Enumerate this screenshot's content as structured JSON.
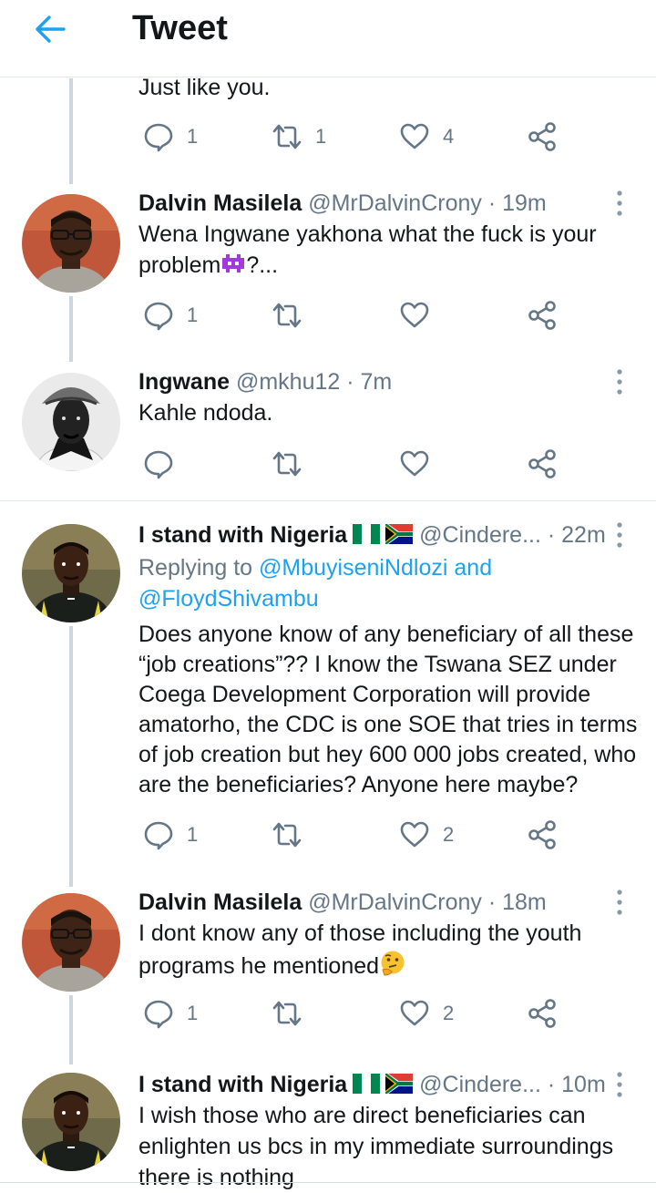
{
  "header": {
    "title": "Tweet"
  },
  "prev_tweet": {
    "text": "Just like you.",
    "replies": "1",
    "retweets": "1",
    "likes": "4"
  },
  "tweets": [
    {
      "name": "Dalvin Masilela",
      "handle": "@MrDalvinCrony",
      "time": "· 19m",
      "text1": "Wena Ingwane yakhona what the fuck is your",
      "text2_start": "problem",
      "text2_end": "?...",
      "replies": "1",
      "retweets": "",
      "likes": ""
    },
    {
      "name": "Ingwane",
      "handle": "@mkhu12",
      "time": "· 7m",
      "text1": "Kahle ndoda.",
      "replies": "",
      "retweets": "",
      "likes": ""
    },
    {
      "name": "I stand with Nigeria",
      "handle": "@Cindere...",
      "time": "· 22m",
      "replying_prefix": "Replying to",
      "replying_to_1": "@MbuyiseniNdlozi",
      "replying_and": "and",
      "replying_to_2": "@FloydShivambu",
      "lines": [
        "Does anyone know of any beneficiary of all these",
        "“job creations”?? I know the Tswana SEZ under",
        "Coega Development Corporation will provide",
        "amatorho, the CDC is one SOE that tries in terms",
        "of job creation but hey 600 000 jobs created, who",
        "are the beneficiaries? Anyone here maybe?"
      ],
      "replies": "1",
      "retweets": "",
      "likes": "2"
    },
    {
      "name": "Dalvin Masilela",
      "handle": "@MrDalvinCrony",
      "time": "· 18m",
      "text1": "I dont know any of those including the youth",
      "text2_start": "programs he mentioned",
      "replies": "1",
      "retweets": "",
      "likes": "2"
    },
    {
      "name": "I stand with Nigeria",
      "handle": "@Cindere...",
      "time": "· 10m",
      "lines": [
        "I wish those who are direct beneficiaries can",
        "enlighten us bcs in my immediate surroundings",
        "there is nothing"
      ]
    }
  ],
  "icons": {
    "back": "arrow-left-icon",
    "reply": "speech-bubble-icon",
    "retweet": "retweet-icon",
    "like": "heart-icon",
    "share": "share-icon",
    "menu": "vertical-dots-icon"
  },
  "colors": {
    "accent": "#1da1f2",
    "muted": "#657786",
    "text": "#14171a"
  }
}
